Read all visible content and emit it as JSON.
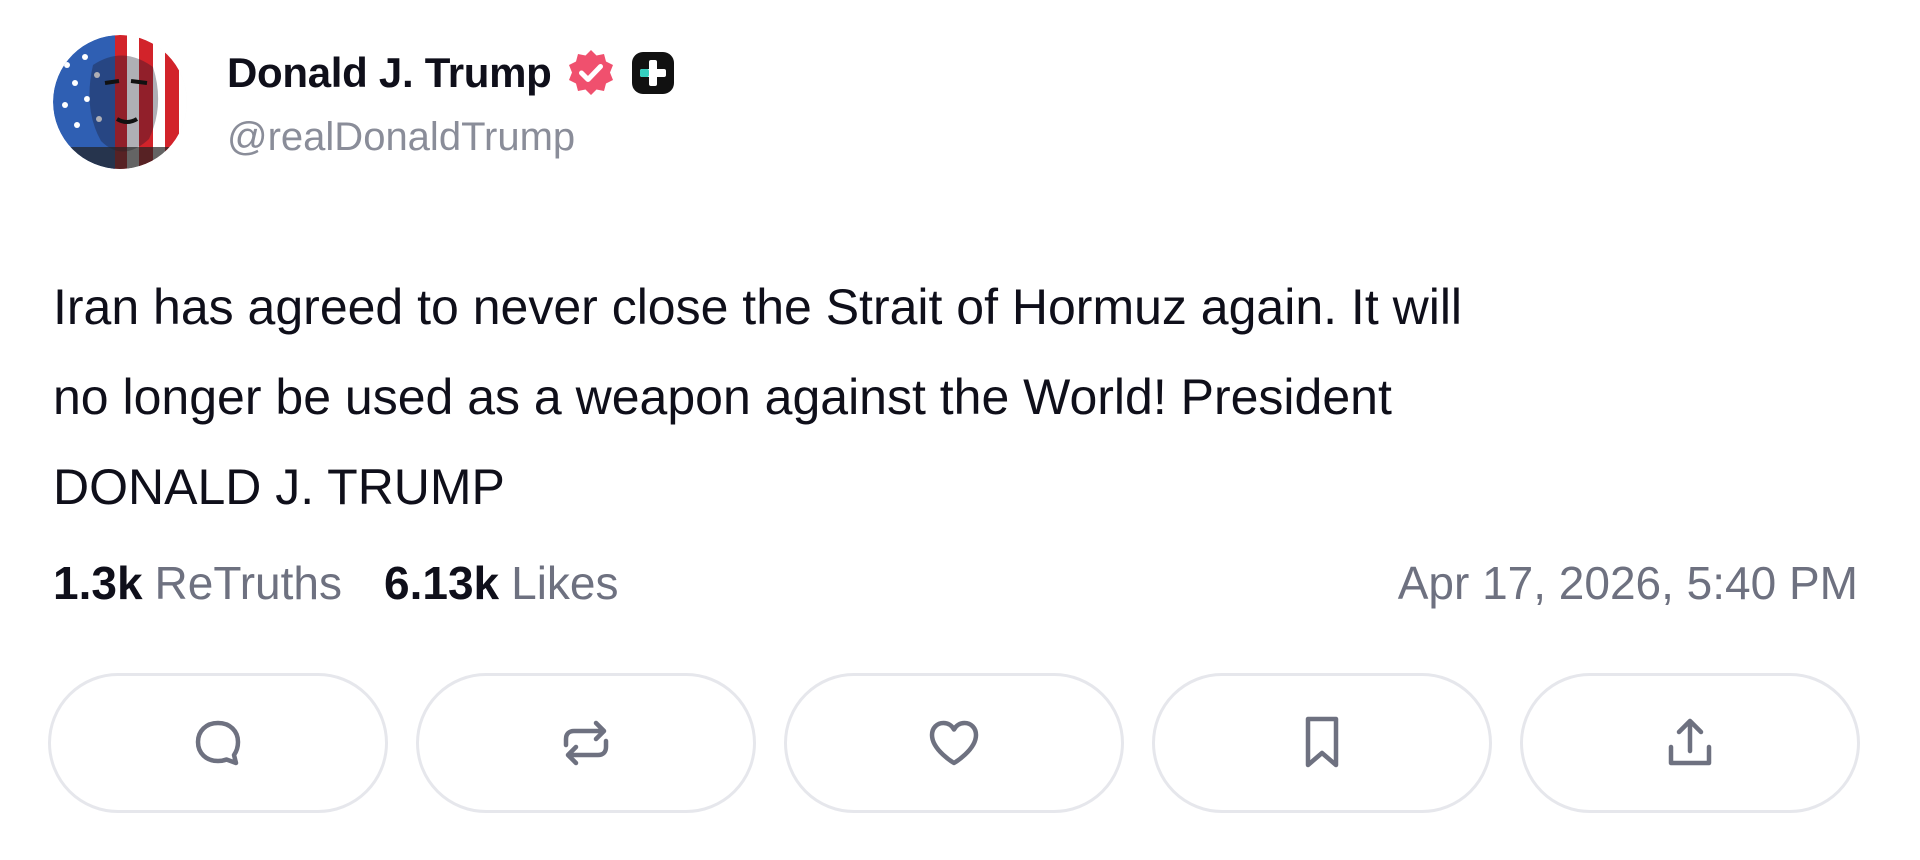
{
  "author": {
    "display_name": "Donald J. Trump",
    "handle": "@realDonaldTrump",
    "verified": true,
    "verified_icon": "verified-badge-icon",
    "plus_icon": "plus-badge-icon",
    "avatar": "avatar-flag-portrait"
  },
  "post": {
    "text": "Iran has agreed to never close the Strait of Hormuz again. It will\nno longer be used as a weapon against the World! President\nDONALD J. TRUMP"
  },
  "stats": {
    "retruths_count": "1.3k",
    "retruths_label": "ReTruths",
    "likes_count": "6.13k",
    "likes_label": "Likes",
    "timestamp": "Apr 17, 2026, 5:40 PM"
  },
  "actions": [
    {
      "name": "reply",
      "icon": "comment-icon"
    },
    {
      "name": "retruth",
      "icon": "repost-icon"
    },
    {
      "name": "like",
      "icon": "heart-icon"
    },
    {
      "name": "bookmark",
      "icon": "bookmark-icon"
    },
    {
      "name": "share",
      "icon": "share-icon"
    }
  ],
  "colors": {
    "verified": "#f0506e",
    "plus_badge": "#111111",
    "plus_accent": "#35d0c0",
    "muted_text": "#6e7180",
    "button_border": "#e6e7ec"
  }
}
